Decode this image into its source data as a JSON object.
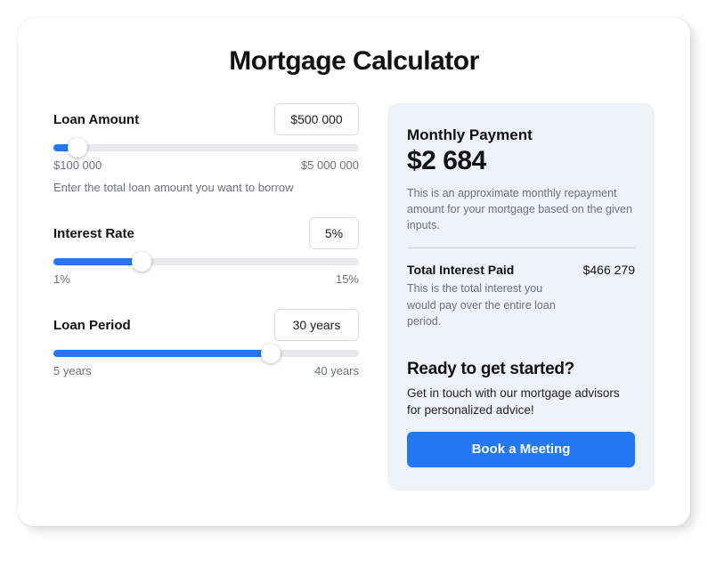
{
  "title": "Mortgage Calculator",
  "fields": {
    "loanAmount": {
      "label": "Loan Amount",
      "value": "$500 000",
      "min": "$100 000",
      "max": "$5 000 000",
      "helper": "Enter the total loan amount you want to borrow",
      "fillPercent": 8
    },
    "interestRate": {
      "label": "Interest Rate",
      "value": "5%",
      "min": "1%",
      "max": "15%",
      "fillPercent": 29
    },
    "loanPeriod": {
      "label": "Loan Period",
      "value": "30 years",
      "min": "5 years",
      "max": "40 years",
      "fillPercent": 71
    }
  },
  "result": {
    "monthlyLabel": "Monthly Payment",
    "monthlyValue": "$2 684",
    "monthlyDesc": "This is an approximate monthly repayment amount for your mortgage based on the given inputs.",
    "interestLabel": "Total Interest Paid",
    "interestValue": "$466 279",
    "interestDesc": "This is the total interest you would pay over the entire loan period."
  },
  "cta": {
    "heading": "Ready to get started?",
    "text": "Get in touch with our mortgage advisors for personalized advice!",
    "button": "Book a Meeting"
  }
}
